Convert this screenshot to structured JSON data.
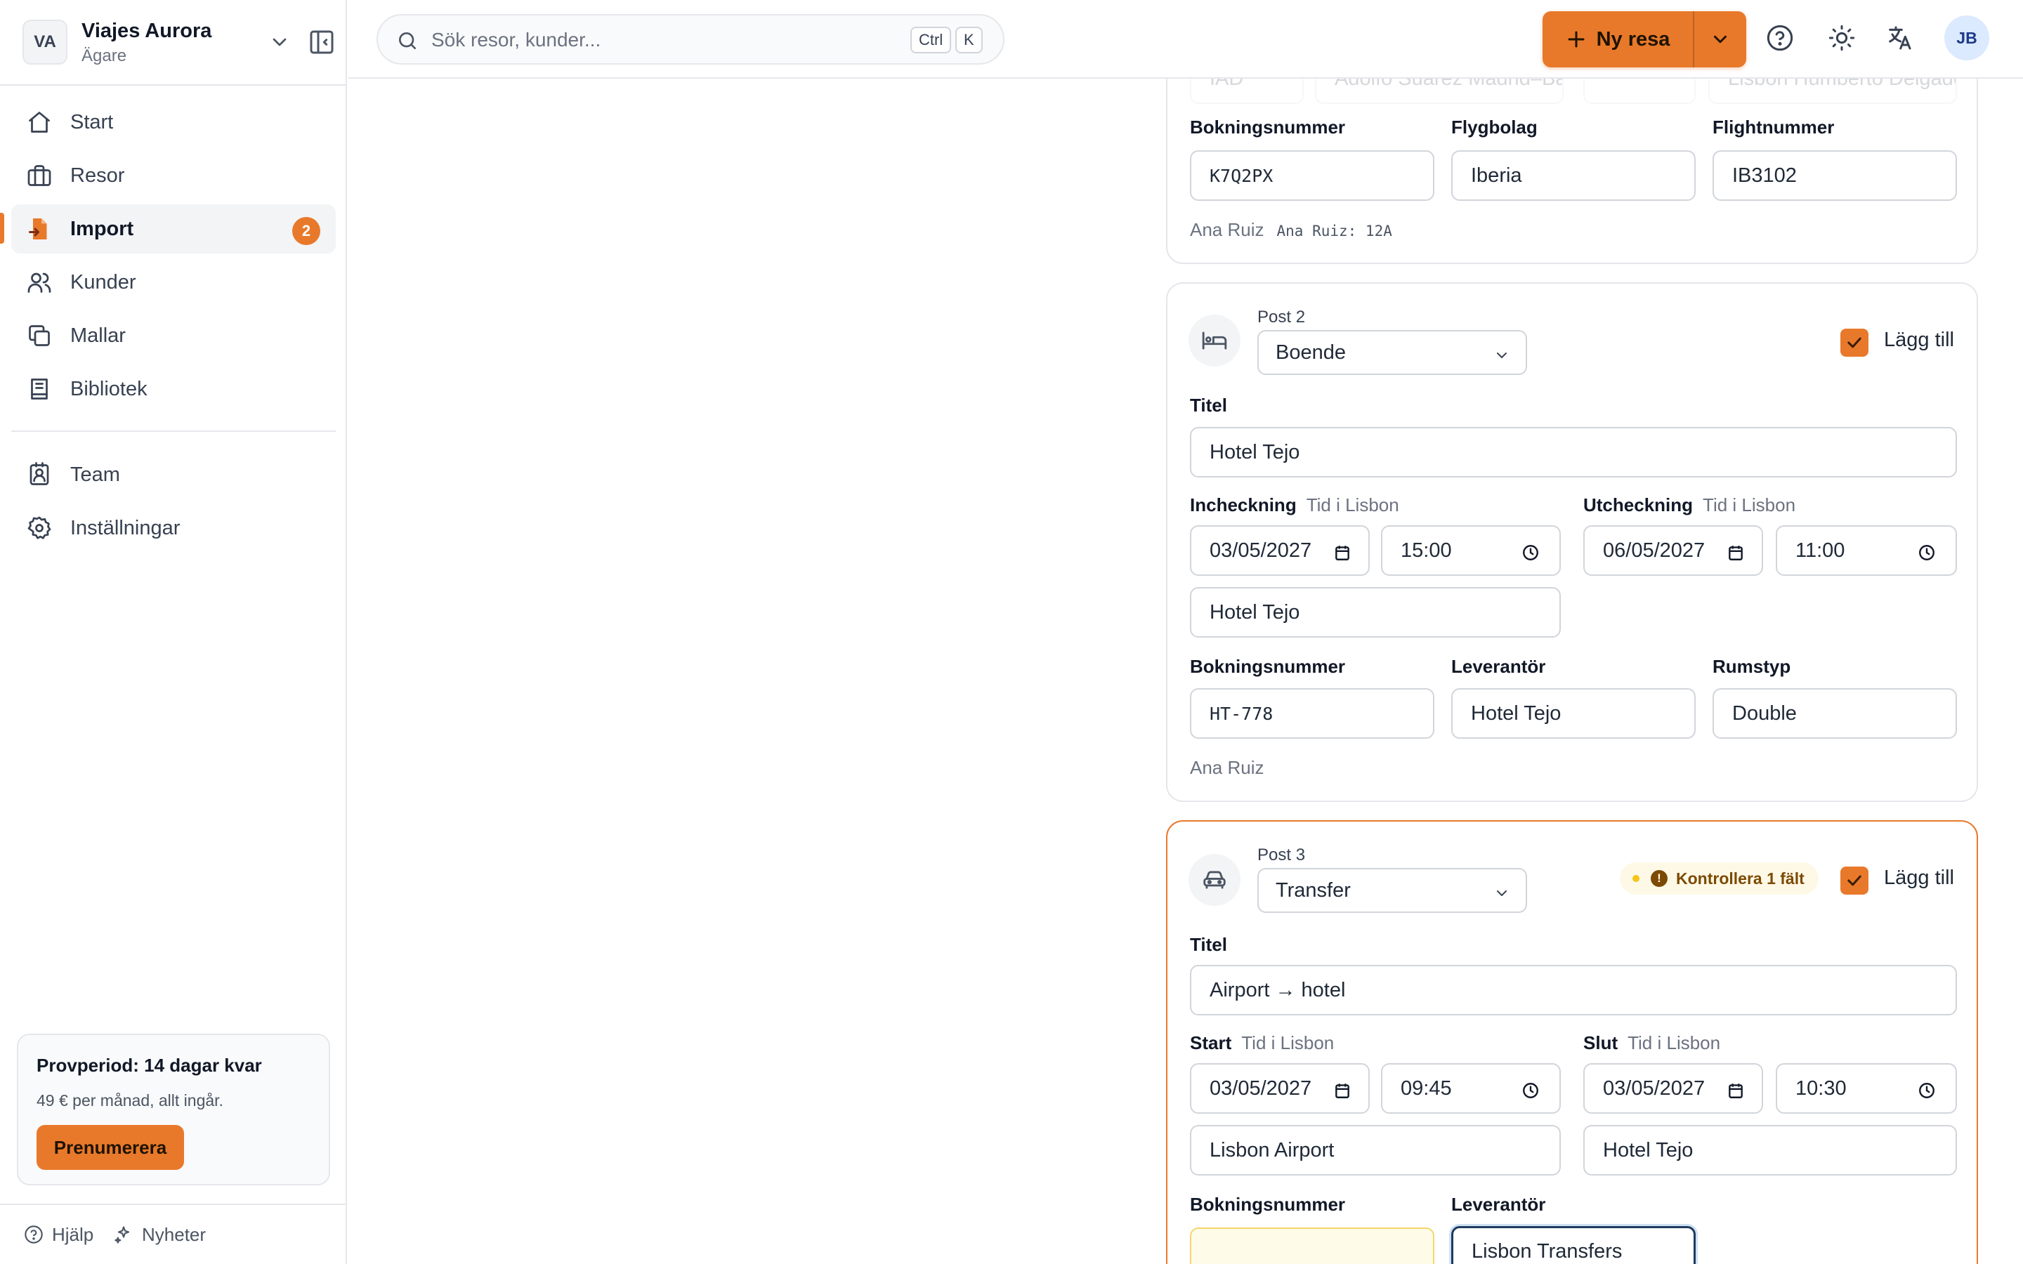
{
  "workspace": {
    "initials": "VA",
    "name": "Viajes Aurora",
    "role": "Ägare"
  },
  "nav": [
    {
      "label": "Start",
      "icon": "home-icon"
    },
    {
      "label": "Resor",
      "icon": "briefcase-icon"
    },
    {
      "label": "Import",
      "icon": "file-import-icon",
      "badge": "2",
      "active": true
    },
    {
      "label": "Kunder",
      "icon": "users-icon"
    },
    {
      "label": "Mallar",
      "icon": "copy-icon"
    },
    {
      "label": "Bibliotek",
      "icon": "book-icon"
    }
  ],
  "nav_secondary": [
    {
      "label": "Team",
      "icon": "contact-icon"
    },
    {
      "label": "Inställningar",
      "icon": "gear-icon"
    }
  ],
  "trial": {
    "title": "Provperiod: 14 dagar kvar",
    "subtitle": "49 € per månad, allt ingår.",
    "button": "Prenumerera"
  },
  "footer": {
    "help": "Hjälp",
    "news": "Nyheter"
  },
  "header": {
    "search_placeholder": "Sök resor, kunder...",
    "kbd_ctrl": "Ctrl",
    "kbd_k": "K",
    "new_trip": "Ny resa",
    "user_initials": "JB"
  },
  "colors": {
    "accent": "#e8792b",
    "warning_bg": "#fef9e7",
    "focus": "#1e3a5f"
  },
  "post1": {
    "faded_top_fields": [
      "IAD",
      "Adolfo Suárez Madrid–Barajas",
      "",
      "Lisbon Humberto Delgado"
    ],
    "booking_label": "Bokningsnummer",
    "booking_value": "K7Q2PX",
    "airline_label": "Flygbolag",
    "airline_value": "Iberia",
    "flight_label": "Flightnummer",
    "flight_value": "IB3102",
    "traveler": "Ana Ruiz",
    "seat": "Ana Ruiz: 12A"
  },
  "post2": {
    "number": "Post 2",
    "type": "Boende",
    "add_label": "Lägg till",
    "title_label": "Titel",
    "title_value": "Hotel Tejo",
    "checkin_label": "Incheckning",
    "checkin_hint": "Tid i Lisbon",
    "checkin_date": "03/05/2027",
    "checkin_time": "15:00",
    "checkout_label": "Utcheckning",
    "checkout_hint": "Tid i Lisbon",
    "checkout_date": "06/05/2027",
    "checkout_time": "11:00",
    "location": "Hotel Tejo",
    "booking_label": "Bokningsnummer",
    "booking_value": "HT-778",
    "supplier_label": "Leverantör",
    "supplier_value": "Hotel Tejo",
    "room_label": "Rumstyp",
    "room_value": "Double",
    "traveler": "Ana Ruiz"
  },
  "post3": {
    "number": "Post 3",
    "type": "Transfer",
    "check_label": "Kontrollera 1 fält",
    "add_label": "Lägg till",
    "title_label": "Titel",
    "title_value": "Airport → hotel",
    "start_label": "Start",
    "start_hint": "Tid i Lisbon",
    "start_date": "03/05/2027",
    "start_time": "09:45",
    "end_label": "Slut",
    "end_hint": "Tid i Lisbon",
    "end_date": "03/05/2027",
    "end_time": "10:30",
    "from_value": "Lisbon Airport",
    "to_value": "Hotel Tejo",
    "booking_label": "Bokningsnummer",
    "booking_value": "",
    "supplier_label": "Leverantör",
    "supplier_value": "Lisbon Transfers"
  }
}
